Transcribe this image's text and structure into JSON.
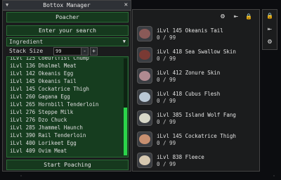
{
  "window": {
    "title": "Bottox Manager",
    "collapse_glyph": "▼",
    "close_glyph": "✕"
  },
  "buttons": {
    "poacher": "Poacher",
    "search": "Enter your search",
    "start": "Start Poaching"
  },
  "filter": {
    "selected": "Ingredient",
    "arrow": "▼"
  },
  "stack": {
    "label": "Stack Size",
    "value": "99",
    "minus": "-",
    "plus": "+"
  },
  "list": {
    "items": [
      "iLvl 125 Coeurlfist Chump",
      "iLvl 136 Dhalmel Meat",
      "iLvl 142 Okeanis Egg",
      "iLvl 145 Okeanis Tail",
      "iLvl 145 Cockatrice Thigh",
      "iLvl 260 Gagana Egg",
      "iLvl 265 Hornbill Tenderloin",
      "iLvl 276 Steppe Milk",
      "iLvl 276 Dzo Chuck",
      "iLvl 285 Jhammel Haunch",
      "iLvl 390 Rail Tenderloin",
      "iLvl 400 Lorikeet Egg",
      "iLvl 409 Ovim Meat"
    ]
  },
  "toolbar": {
    "gear_icon": "⚙",
    "back_icon": "⇤",
    "lock_icon": "🔒"
  },
  "side": {
    "lock_icon": "🔒",
    "back_icon": "⇤",
    "gear_icon": "⚙"
  },
  "inventory": [
    {
      "name": "iLvl 145 Okeanis Tail",
      "count": "0 / 99",
      "color": "#8a5a58"
    },
    {
      "name": "iLvl 418 Sea Swallow Skin",
      "count": "0 / 99",
      "color": "#7a3a34"
    },
    {
      "name": "iLvl 412 Zonure Skin",
      "count": "0 / 99",
      "color": "#b08a90"
    },
    {
      "name": "iLvl 418 Cubus Flesh",
      "count": "0 / 99",
      "color": "#b9c8d6"
    },
    {
      "name": "iLvl 385 Island Wolf Fang",
      "count": "0 / 99",
      "color": "#d8d8c8"
    },
    {
      "name": "iLvl 145 Cockatrice Thigh",
      "count": "0 / 99",
      "color": "#c89070"
    },
    {
      "name": "iLvl 838 Fleece",
      "count": "0 / 99",
      "color": "#d6c8b0"
    }
  ]
}
